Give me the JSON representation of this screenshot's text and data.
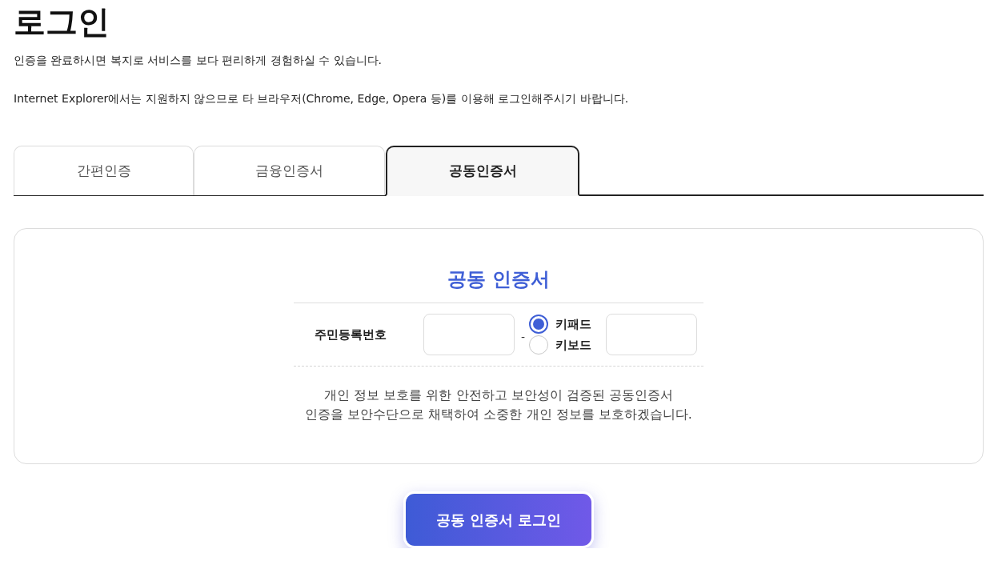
{
  "page": {
    "title": "로그인",
    "intro": [
      "인증을 완료하시면 복지로 서비스를 보다 편리하게 경험하실 수 있습니다.",
      "Internet Explorer에서는 지원하지 않으므로 타 브라우저(Chrome, Edge, Opera 등)를 이용해 로그인해주시기 바랍니다."
    ]
  },
  "tabs": [
    {
      "label": "간편인증",
      "selected": false
    },
    {
      "label": "금융인증서",
      "selected": false
    },
    {
      "label": "공동인증서",
      "selected": true
    }
  ],
  "panel": {
    "heading": "공동 인증서",
    "field_label": "주민등록번호",
    "separator": "-",
    "input_modes": [
      {
        "label": "키패드",
        "selected": true
      },
      {
        "label": "키보드",
        "selected": false
      }
    ],
    "description": [
      "개인 정보 보호를 위한 안전하고 보안성이 검증된 공동인증서",
      "인증을 보안수단으로 채택하여 소중한 개인 정보를 보호하겠습니다."
    ]
  },
  "login_button": {
    "label": "공동 인증서 로그인"
  }
}
